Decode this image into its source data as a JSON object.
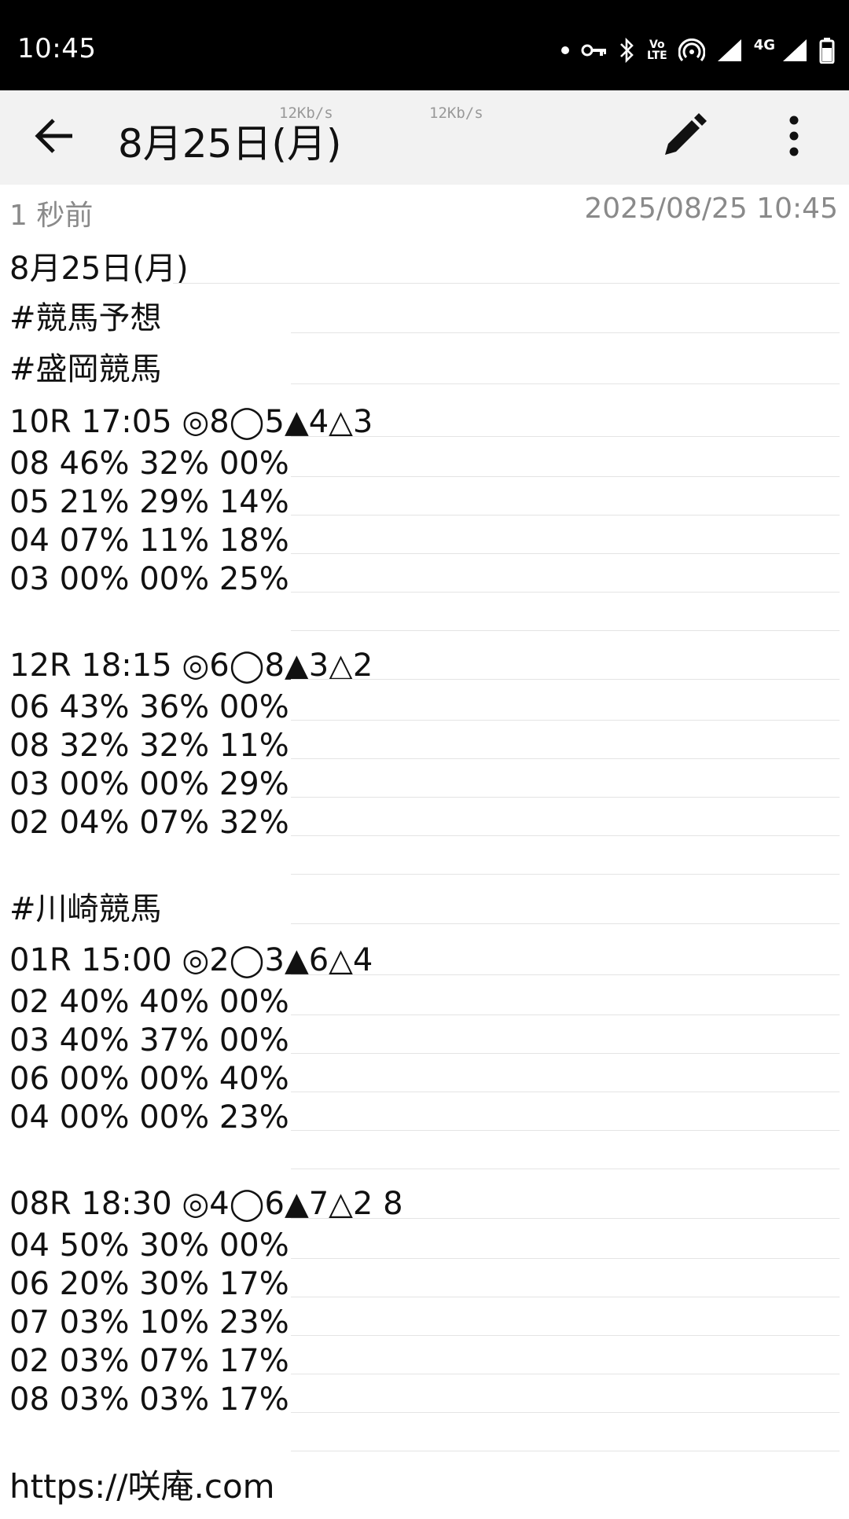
{
  "status_bar": {
    "time": "10:45",
    "icons": [
      "notification-dot-icon",
      "vpn-key-icon",
      "bluetooth-icon",
      "volte-icon",
      "hotspot-icon",
      "signal-icon",
      "signal-4g-icon",
      "battery-icon"
    ],
    "volte_label_top": "Vo",
    "volte_label_bottom": "LTE",
    "network_label": "4G"
  },
  "app_bar": {
    "title": "8月25日(月)",
    "speed_1": "12Kb/s",
    "speed_2": "12Kb/s",
    "icons": [
      "back-arrow-icon",
      "edit-pencil-icon",
      "more-vert-icon"
    ]
  },
  "meta": {
    "relative_time": "1 秒前",
    "timestamp": "2025/08/25 10:45"
  },
  "note_lines": [
    "8月25日(月)",
    "#競馬予想",
    "#盛岡競馬",
    "10R 17:05 ◎8◯5▲4△3",
    "08 46% 32% 00%",
    "05 21% 29% 14%",
    "04 07% 11% 18%",
    "03 00% 00% 25%",
    "",
    "12R 18:15 ◎6◯8▲3△2",
    "06 43% 36% 00%",
    "08 32% 32% 11%",
    "03 00% 00% 29%",
    "02 04% 07% 32%",
    "",
    "#川崎競馬",
    "01R 15:00 ◎2◯3▲6△4",
    "02 40% 40% 00%",
    "03 40% 37% 00%",
    "06 00% 00% 40%",
    "04 00% 00% 23%",
    "",
    "08R 18:30 ◎4◯6▲7△2 8",
    "04 50% 30% 00%",
    "06 20% 30% 17%",
    "07 03% 10% 23%",
    "02 03% 07% 17%",
    "08 03% 03% 17%",
    "",
    "https://咲庵.com"
  ]
}
